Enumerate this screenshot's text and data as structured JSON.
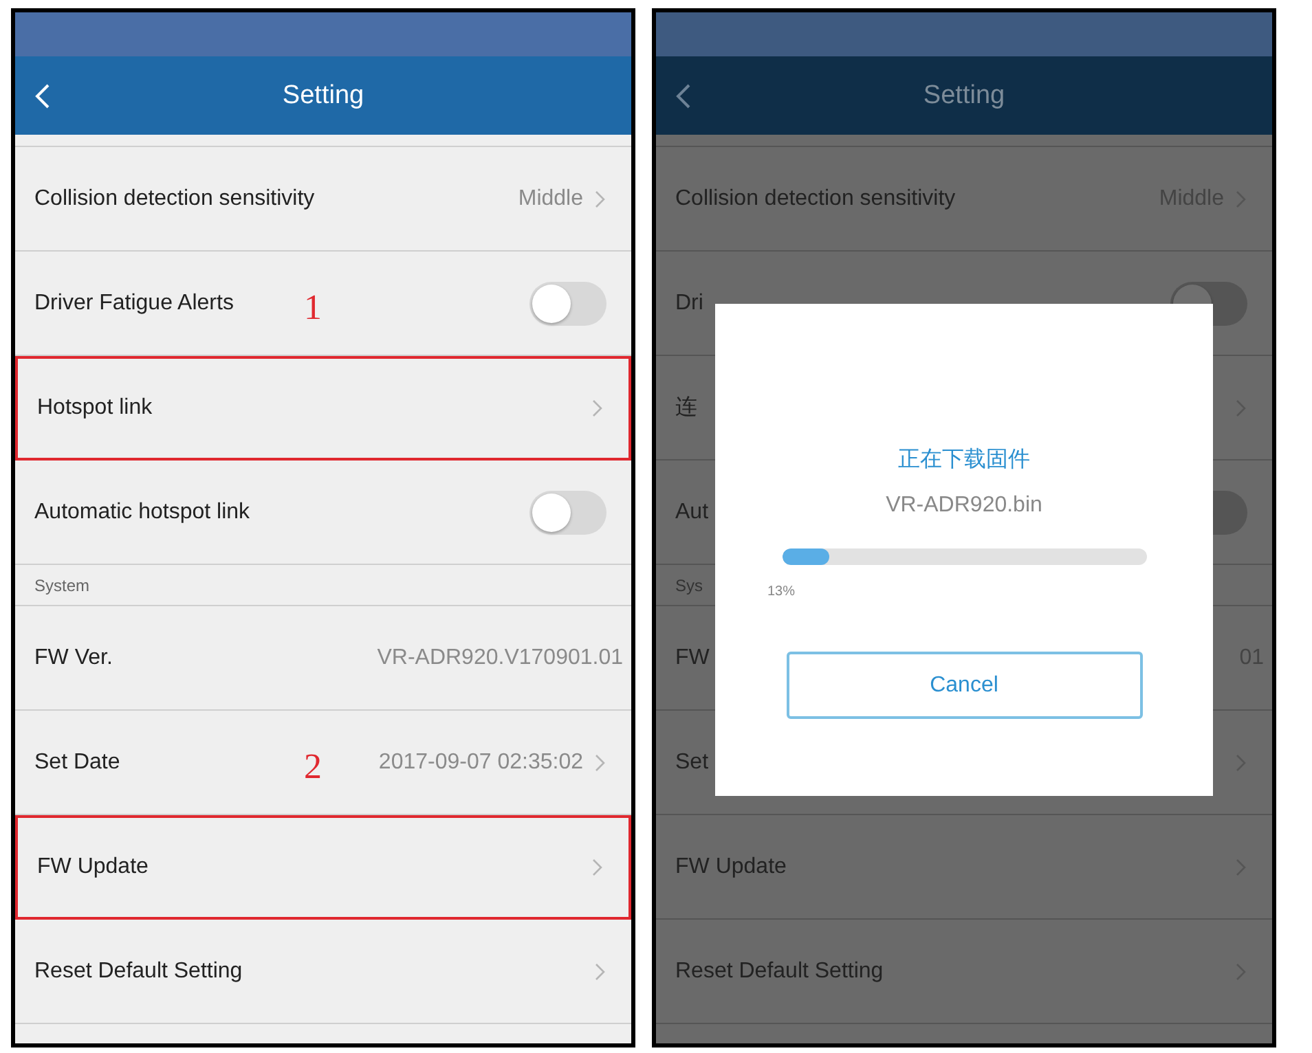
{
  "screens": [
    {
      "dimmed": false,
      "header": {
        "title": "Setting"
      },
      "rows": [
        {
          "kind": "link",
          "label": "Collision detection sensitivity",
          "value": "Middle",
          "highlighted": false
        },
        {
          "kind": "toggle",
          "label": "Driver Fatigue Alerts",
          "on": false,
          "annotation": "1",
          "highlighted": false
        },
        {
          "kind": "link",
          "label": "Hotspot link",
          "highlighted": true
        },
        {
          "kind": "toggle",
          "label": "Automatic hotspot link",
          "on": false,
          "highlighted": false
        },
        {
          "kind": "section",
          "label": "System",
          "highlighted": false
        },
        {
          "kind": "info",
          "label": "FW Ver.",
          "value": "VR-ADR920.V170901.01",
          "highlighted": false
        },
        {
          "kind": "link",
          "label": "Set Date",
          "value": "2017-09-07 02:35:02",
          "annotation": "2",
          "highlighted": false
        },
        {
          "kind": "link",
          "label": "FW Update",
          "highlighted": true
        },
        {
          "kind": "link",
          "label": "Reset Default Setting",
          "highlighted": false
        }
      ]
    },
    {
      "dimmed": true,
      "header": {
        "title": "Setting"
      },
      "rows": [
        {
          "kind": "link",
          "label": "Collision detection sensitivity",
          "value": "Middle",
          "highlighted": false
        },
        {
          "kind": "toggle",
          "label": "Dri",
          "on": false,
          "highlighted": false
        },
        {
          "kind": "link",
          "label": "连",
          "highlighted": false
        },
        {
          "kind": "toggle",
          "label": "Aut",
          "on": false,
          "highlighted": false
        },
        {
          "kind": "section",
          "label": "Sys",
          "highlighted": false
        },
        {
          "kind": "info",
          "label": "FW",
          "value": "01",
          "highlighted": false
        },
        {
          "kind": "link",
          "label": "Set",
          "highlighted": false
        },
        {
          "kind": "link",
          "label": "FW Update",
          "highlighted": false
        },
        {
          "kind": "link",
          "label": "Reset Default Setting",
          "highlighted": false
        }
      ],
      "dialog": {
        "title": "正在下载固件",
        "filename": "VR-ADR920.bin",
        "progress": {
          "level": 0.13,
          "reading": "13%"
        },
        "button": "Cancel"
      }
    }
  ]
}
